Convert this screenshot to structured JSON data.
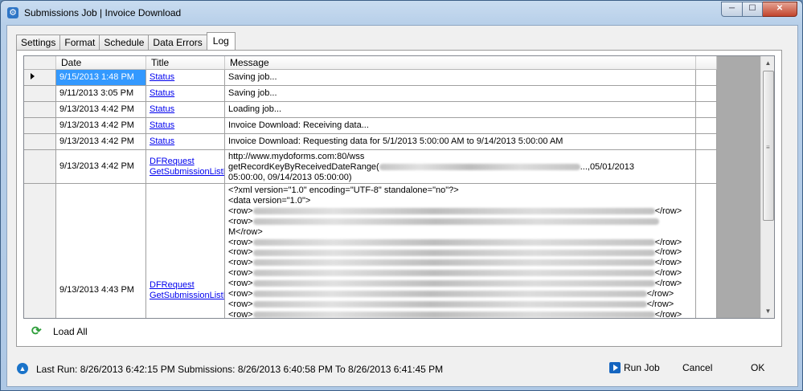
{
  "window": {
    "title": "Submissions Job | Invoice Download",
    "min": "─",
    "max": "☐",
    "close": "✕"
  },
  "tabs": [
    "Settings",
    "Format",
    "Schedule",
    "Data Errors",
    "Log"
  ],
  "grid": {
    "headers": {
      "date": "Date",
      "title": "Title",
      "message": "Message"
    },
    "rows": [
      {
        "date": "9/15/2013 1:48 PM",
        "title": "Status",
        "message": "Saving job..."
      },
      {
        "date": "9/11/2013 3:05 PM",
        "title": "Status",
        "message": "Saving job..."
      },
      {
        "date": "9/13/2013 4:42 PM",
        "title": "Status",
        "message": "Loading job..."
      },
      {
        "date": "9/13/2013 4:42 PM",
        "title": "Status",
        "message": "Invoice Download: Receiving data..."
      },
      {
        "date": "9/13/2013 4:42 PM",
        "title": "Status",
        "message": "Invoice Download: Requesting data for 5/1/2013 5:00:00 AM to 9/14/2013 5:00:00 AM"
      },
      {
        "date": "9/13/2013 4:42 PM",
        "title_line1": "DFRequest",
        "title_line2": "GetSubmissionListR",
        "msg_line1": "http://www.mydoforms.com:80/wss",
        "msg_line2a": "getRecordKeyByReceivedDateRange(",
        "msg_line2b": "...,05/01/2013",
        "msg_line3": "05:00:00, 09/14/2013 05:00:00)"
      },
      {
        "date": "9/13/2013 4:43 PM",
        "title_line1": "DFRequest",
        "title_line2": "GetSubmissionListR",
        "xml_decl": "<?xml version=\"1.0\" encoding=\"UTF-8\" standalone=\"no\"?>",
        "data_open": "<data version=\"1.0\">",
        "row_open": "<row>",
        "row_close": "</row>",
        "row_close_m": "M</row>"
      }
    ]
  },
  "load_all": "Load All",
  "status": {
    "text": "Last Run: 8/26/2013 6:42:15 PM  Submissions: 8/26/2013 6:40:58 PM To 8/26/2013 6:41:45 PM"
  },
  "buttons": {
    "run_job": "Run Job",
    "cancel": "Cancel",
    "ok": "OK"
  }
}
